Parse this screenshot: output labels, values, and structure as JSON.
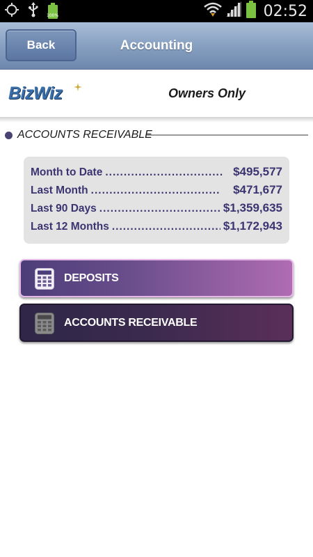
{
  "status_bar": {
    "time": "02:52",
    "battery_small_label": "100%",
    "icons": [
      "location-target-icon",
      "usb-icon",
      "battery-full-small-icon",
      "wifi-icon",
      "signal-icon",
      "battery-icon"
    ]
  },
  "header": {
    "back_label": "Back",
    "title": "Accounting"
  },
  "brand": {
    "logo_text": "BizWiz",
    "subtitle": "Owners Only"
  },
  "section": {
    "title": "ACCOUNTS RECEIVABLE"
  },
  "summary": {
    "rows": [
      {
        "label": "Month to Date",
        "dots": "................................",
        "value": "$495,577"
      },
      {
        "label": "Last Month",
        "dots": "...................................",
        "value": "$471,677"
      },
      {
        "label": "Last 90 Days",
        "dots": "..................................",
        "value": "$1,359,635"
      },
      {
        "label": "Last 12 Months",
        "dots": "..............................",
        "value": "$1,172,943"
      }
    ]
  },
  "actions": {
    "deposits_label": "DEPOSITS",
    "accounts_receivable_label": "ACCOUNTS RECEIVABLE"
  },
  "colors": {
    "header_blue": "#8aa3c3",
    "summary_text": "#3b3470",
    "deposits_gradient_end": "#b06cb2",
    "ar_gradient_start": "#2f2747"
  }
}
